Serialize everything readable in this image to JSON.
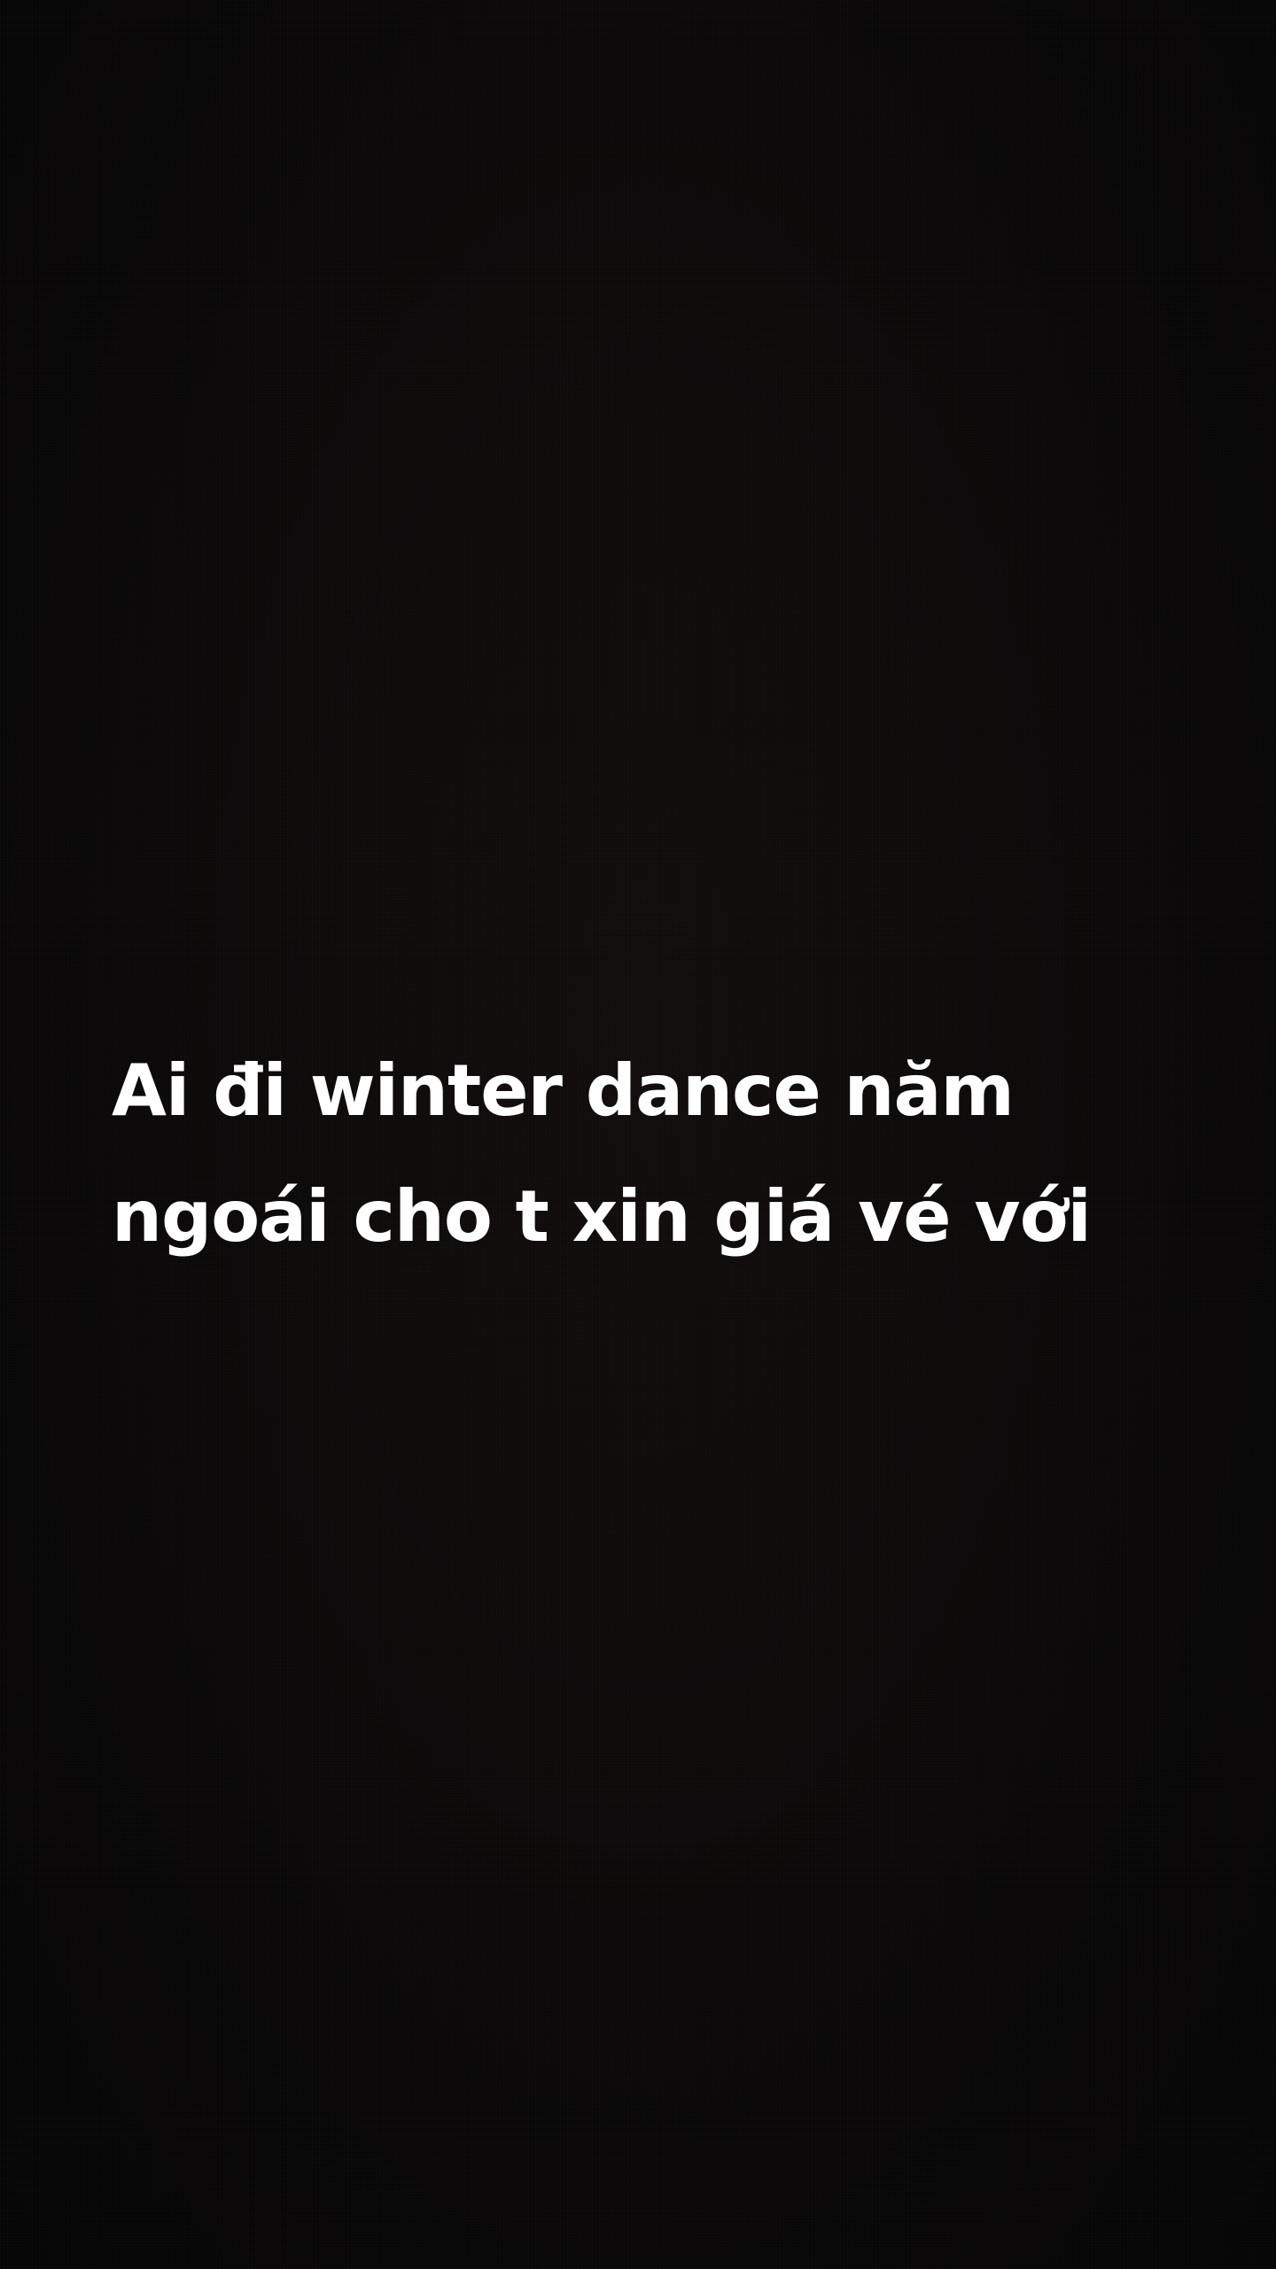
{
  "story": {
    "text_lines": [
      "Ai đi winter dance năm",
      "ngoái cho t xin giá vé với"
    ],
    "background_color": "#0b0909",
    "text_color": "#ffffff"
  }
}
